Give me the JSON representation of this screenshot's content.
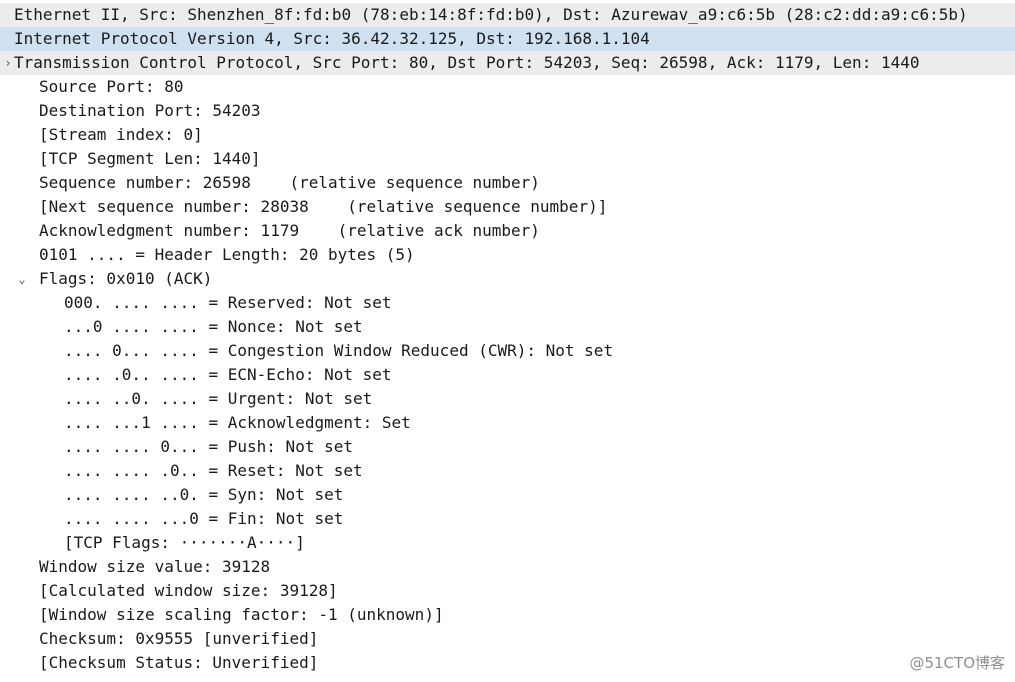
{
  "tree": {
    "rows": [
      {
        "id": "eth",
        "indent": 0,
        "toggle": "",
        "text": "Ethernet II, Src: Shenzhen_8f:fd:b0 (78:eb:14:8f:fd:b0), Dst: Azurewav_a9:c6:5b (28:c2:dd:a9:c6:5b)",
        "bg": "header"
      },
      {
        "id": "ip",
        "indent": 0,
        "toggle": "",
        "text": "Internet Protocol Version 4, Src: 36.42.32.125, Dst: 192.168.1.104",
        "bg": "selected"
      },
      {
        "id": "tcp",
        "indent": 0,
        "toggle": "›",
        "text": "Transmission Control Protocol, Src Port: 80, Dst Port: 54203, Seq: 26598, Ack: 1179, Len: 1440",
        "bg": "header"
      },
      {
        "id": "srcport",
        "indent": 1,
        "toggle": "",
        "text": "Source Port: 80",
        "bg": ""
      },
      {
        "id": "dstport",
        "indent": 1,
        "toggle": "",
        "text": "Destination Port: 54203",
        "bg": ""
      },
      {
        "id": "stream",
        "indent": 1,
        "toggle": "",
        "text": "[Stream index: 0]",
        "bg": ""
      },
      {
        "id": "seglen",
        "indent": 1,
        "toggle": "",
        "text": "[TCP Segment Len: 1440]",
        "bg": ""
      },
      {
        "id": "seq",
        "indent": 1,
        "toggle": "",
        "text": "Sequence number: 26598    (relative sequence number)",
        "bg": ""
      },
      {
        "id": "nextseq",
        "indent": 1,
        "toggle": "",
        "text": "[Next sequence number: 28038    (relative sequence number)]",
        "bg": ""
      },
      {
        "id": "ack",
        "indent": 1,
        "toggle": "",
        "text": "Acknowledgment number: 1179    (relative ack number)",
        "bg": ""
      },
      {
        "id": "hdrlen",
        "indent": 1,
        "toggle": "",
        "text": "0101 .... = Header Length: 20 bytes (5)",
        "bg": ""
      },
      {
        "id": "flags",
        "indent": 1,
        "toggle": "⌄",
        "text": "Flags: 0x010 (ACK)",
        "bg": ""
      },
      {
        "id": "f-reserved",
        "indent": 2,
        "toggle": "",
        "text": "000. .... .... = Reserved: Not set",
        "bg": ""
      },
      {
        "id": "f-nonce",
        "indent": 2,
        "toggle": "",
        "text": "...0 .... .... = Nonce: Not set",
        "bg": ""
      },
      {
        "id": "f-cwr",
        "indent": 2,
        "toggle": "",
        "text": ".... 0... .... = Congestion Window Reduced (CWR): Not set",
        "bg": ""
      },
      {
        "id": "f-ecn",
        "indent": 2,
        "toggle": "",
        "text": ".... .0.. .... = ECN-Echo: Not set",
        "bg": ""
      },
      {
        "id": "f-urg",
        "indent": 2,
        "toggle": "",
        "text": ".... ..0. .... = Urgent: Not set",
        "bg": ""
      },
      {
        "id": "f-ack",
        "indent": 2,
        "toggle": "",
        "text": ".... ...1 .... = Acknowledgment: Set",
        "bg": ""
      },
      {
        "id": "f-push",
        "indent": 2,
        "toggle": "",
        "text": ".... .... 0... = Push: Not set",
        "bg": ""
      },
      {
        "id": "f-reset",
        "indent": 2,
        "toggle": "",
        "text": ".... .... .0.. = Reset: Not set",
        "bg": ""
      },
      {
        "id": "f-syn",
        "indent": 2,
        "toggle": "",
        "text": ".... .... ..0. = Syn: Not set",
        "bg": ""
      },
      {
        "id": "f-fin",
        "indent": 2,
        "toggle": "",
        "text": ".... .... ...0 = Fin: Not set",
        "bg": ""
      },
      {
        "id": "f-tcpflags",
        "indent": 2,
        "toggle": "",
        "text": "[TCP Flags: ·······A····]",
        "bg": ""
      },
      {
        "id": "winsize",
        "indent": 1,
        "toggle": "",
        "text": "Window size value: 39128",
        "bg": ""
      },
      {
        "id": "calcwin",
        "indent": 1,
        "toggle": "",
        "text": "[Calculated window size: 39128]",
        "bg": ""
      },
      {
        "id": "winscale",
        "indent": 1,
        "toggle": "",
        "text": "[Window size scaling factor: -1 (unknown)]",
        "bg": ""
      },
      {
        "id": "checksum",
        "indent": 1,
        "toggle": "",
        "text": "Checksum: 0x9555 [unverified]",
        "bg": ""
      },
      {
        "id": "chkstatus",
        "indent": 1,
        "toggle": "",
        "text": "[Checksum Status: Unverified]",
        "bg": ""
      }
    ]
  },
  "watermark": "@51CTO博客",
  "colors": {
    "header_bg": "#ececec",
    "selected_bg": "#cfe0f1",
    "text": "#1a1a1a",
    "watermark": "#8f8f8f"
  }
}
